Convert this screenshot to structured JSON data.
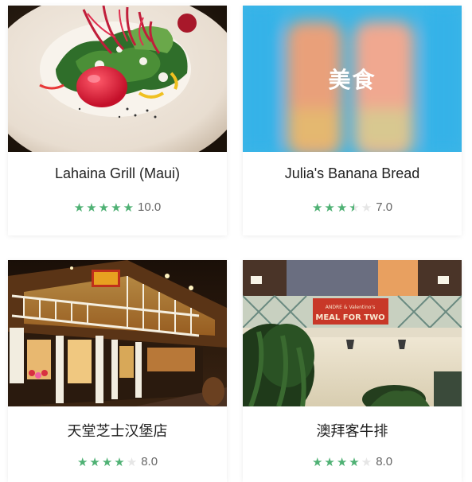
{
  "cards": [
    {
      "title": "Lahaina Grill (Maui)",
      "stars": [
        "on",
        "on",
        "on",
        "on",
        "on"
      ],
      "score": "10.0",
      "image": "salad-photo"
    },
    {
      "title": "Julia's Banana Bread",
      "stars": [
        "on",
        "on",
        "on",
        "half",
        "off"
      ],
      "score": "7.0",
      "image": "placeholder",
      "image_label": "美食"
    },
    {
      "title": "天堂芝士汉堡店",
      "stars": [
        "on",
        "on",
        "on",
        "on",
        "off"
      ],
      "score": "8.0",
      "image": "restaurant-exterior-photo"
    },
    {
      "title": "澳拜客牛排",
      "stars": [
        "on",
        "on",
        "on",
        "on",
        "off"
      ],
      "score": "8.0",
      "image": "storefront-photo",
      "sign_line1": "ANDRE & Valentino's",
      "sign_line2": "MEAL FOR TWO"
    }
  ],
  "colors": {
    "star_on": "#4fb174",
    "star_off": "#e6e6e6",
    "placeholder_bg": "#3db6e6"
  }
}
